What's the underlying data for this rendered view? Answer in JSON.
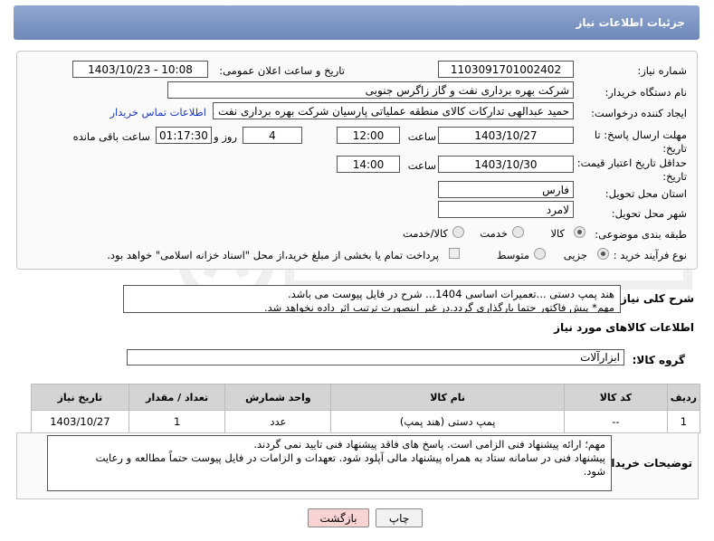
{
  "header": {
    "title": "جزئیات اطلاعات نیاز"
  },
  "form": {
    "need_number_label": "شماره نیاز:",
    "need_number": "1103091701002402",
    "announce_label": "تاریخ و ساعت اعلان عمومی:",
    "announce_value": "1403/10/23 - 10:08",
    "buyer_org_label": "نام دستگاه خریدار:",
    "buyer_org": "شرکت بهره برداری نفت و گاز زاگرس جنوبی",
    "creator_label": "ایجاد کننده درخواست:",
    "creator": "حمید عبدالهی تدارکات کالای منطقه عملیاتی پارسیان شرکت بهره برداری نفت و",
    "contact_link": "اطلاعات تماس خریدار",
    "deadline_label": "مهلت ارسال پاسخ: تا تاریخ:",
    "deadline_date": "1403/10/27",
    "time_label": "ساعت",
    "deadline_time": "12:00",
    "days_value": "4",
    "days_label": "روز و",
    "remaining_time": "01:17:30",
    "remaining_label": "ساعت باقی مانده",
    "validity_label": "حداقل تاریخ اعتبار قیمت: تا تاریخ:",
    "validity_date": "1403/10/30",
    "validity_time": "14:00",
    "province_label": "استان محل تحویل:",
    "province": "فارس",
    "city_label": "شهر محل تحویل:",
    "city": "لامرد",
    "category_label": "طبقه بندی موضوعی:",
    "category_options": [
      "کالا",
      "خدمت",
      "کالا/خدمت"
    ],
    "process_label": "نوع فرآیند خرید :",
    "process_options": [
      "جزیی",
      "متوسط"
    ],
    "payment_note": "پرداخت تمام یا بخشی از مبلغ خرید،از محل \"اسناد خزانه اسلامی\" خواهد بود."
  },
  "description": {
    "label": "شرح کلی نیاز:",
    "line1": "هند پمپ دستی ...تعمیرات اساسی 1404... شرح در فایل پیوست می باشد.",
    "line2": "مهم* پیش فاکتور حتما بارگذاری گردد.در غیر اینصورت ترتیب اثر داده نخواهد شد."
  },
  "goods": {
    "section_title": "اطلاعات کالاهای مورد نیاز",
    "group_label": "گروه کالا:",
    "group_value": "ابزارآلات",
    "columns": [
      "ردیف",
      "کد کالا",
      "نام کالا",
      "واحد شمارش",
      "تعداد / مقدار",
      "تاریخ نیاز"
    ],
    "rows": [
      [
        "1",
        "--",
        "پمپ دستی (هند پمپ)",
        "عدد",
        "1",
        "1403/10/27"
      ]
    ]
  },
  "buyer_notes": {
    "label": "توضیحات خریدار:",
    "line1": "مهم؛ ارائه پیشنهاد فنی الزامی است. پاسخ های فاقد پیشنهاد فنی تایید نمی گردند.",
    "line2": "پیشنهاد فنی در سامانه ستاد به همراه پیشنهاد مالی آپلود شود. تعهدات و الزامات در فایل پیوست حتماً مطالعه و رعایت",
    "line3": "شود."
  },
  "buttons": {
    "print": "چاپ",
    "back": "بازگشت"
  },
  "colors": {
    "title_bar": "#7b93c2",
    "back_button": "#f7d3d3",
    "link": "#1a37c8"
  }
}
